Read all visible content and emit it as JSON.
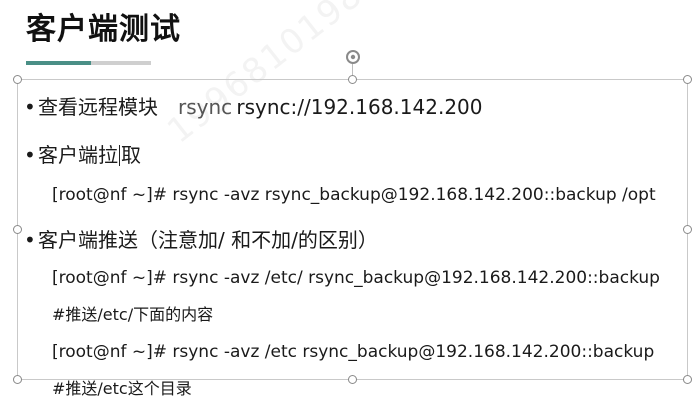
{
  "slide": {
    "title": "客户端测试",
    "accent_color": "#4a8f86",
    "watermark": "1996810198"
  },
  "bullets": [
    {
      "label_prefix": "查看远程模块",
      "label_mid": "rsync",
      "label_suffix": "rsync://192.168.142.200"
    },
    {
      "label_prefix": "客户端拉",
      "label_suffix": "取",
      "code": "[root@nf ~]# rsync -avz rsync_backup@192.168.142.200::backup /opt"
    },
    {
      "label": "客户端推送（注意加/ 和不加/的区别）",
      "code_lines": [
        "[root@nf ~]# rsync -avz /etc/ rsync_backup@192.168.142.200::backup",
        "#推送/etc/下面的内容",
        "[root@nf ~]# rsync -avz /etc rsync_backup@192.168.142.200::backup",
        "#推送/etc这个目录"
      ]
    }
  ],
  "bullet_glyph": "•"
}
